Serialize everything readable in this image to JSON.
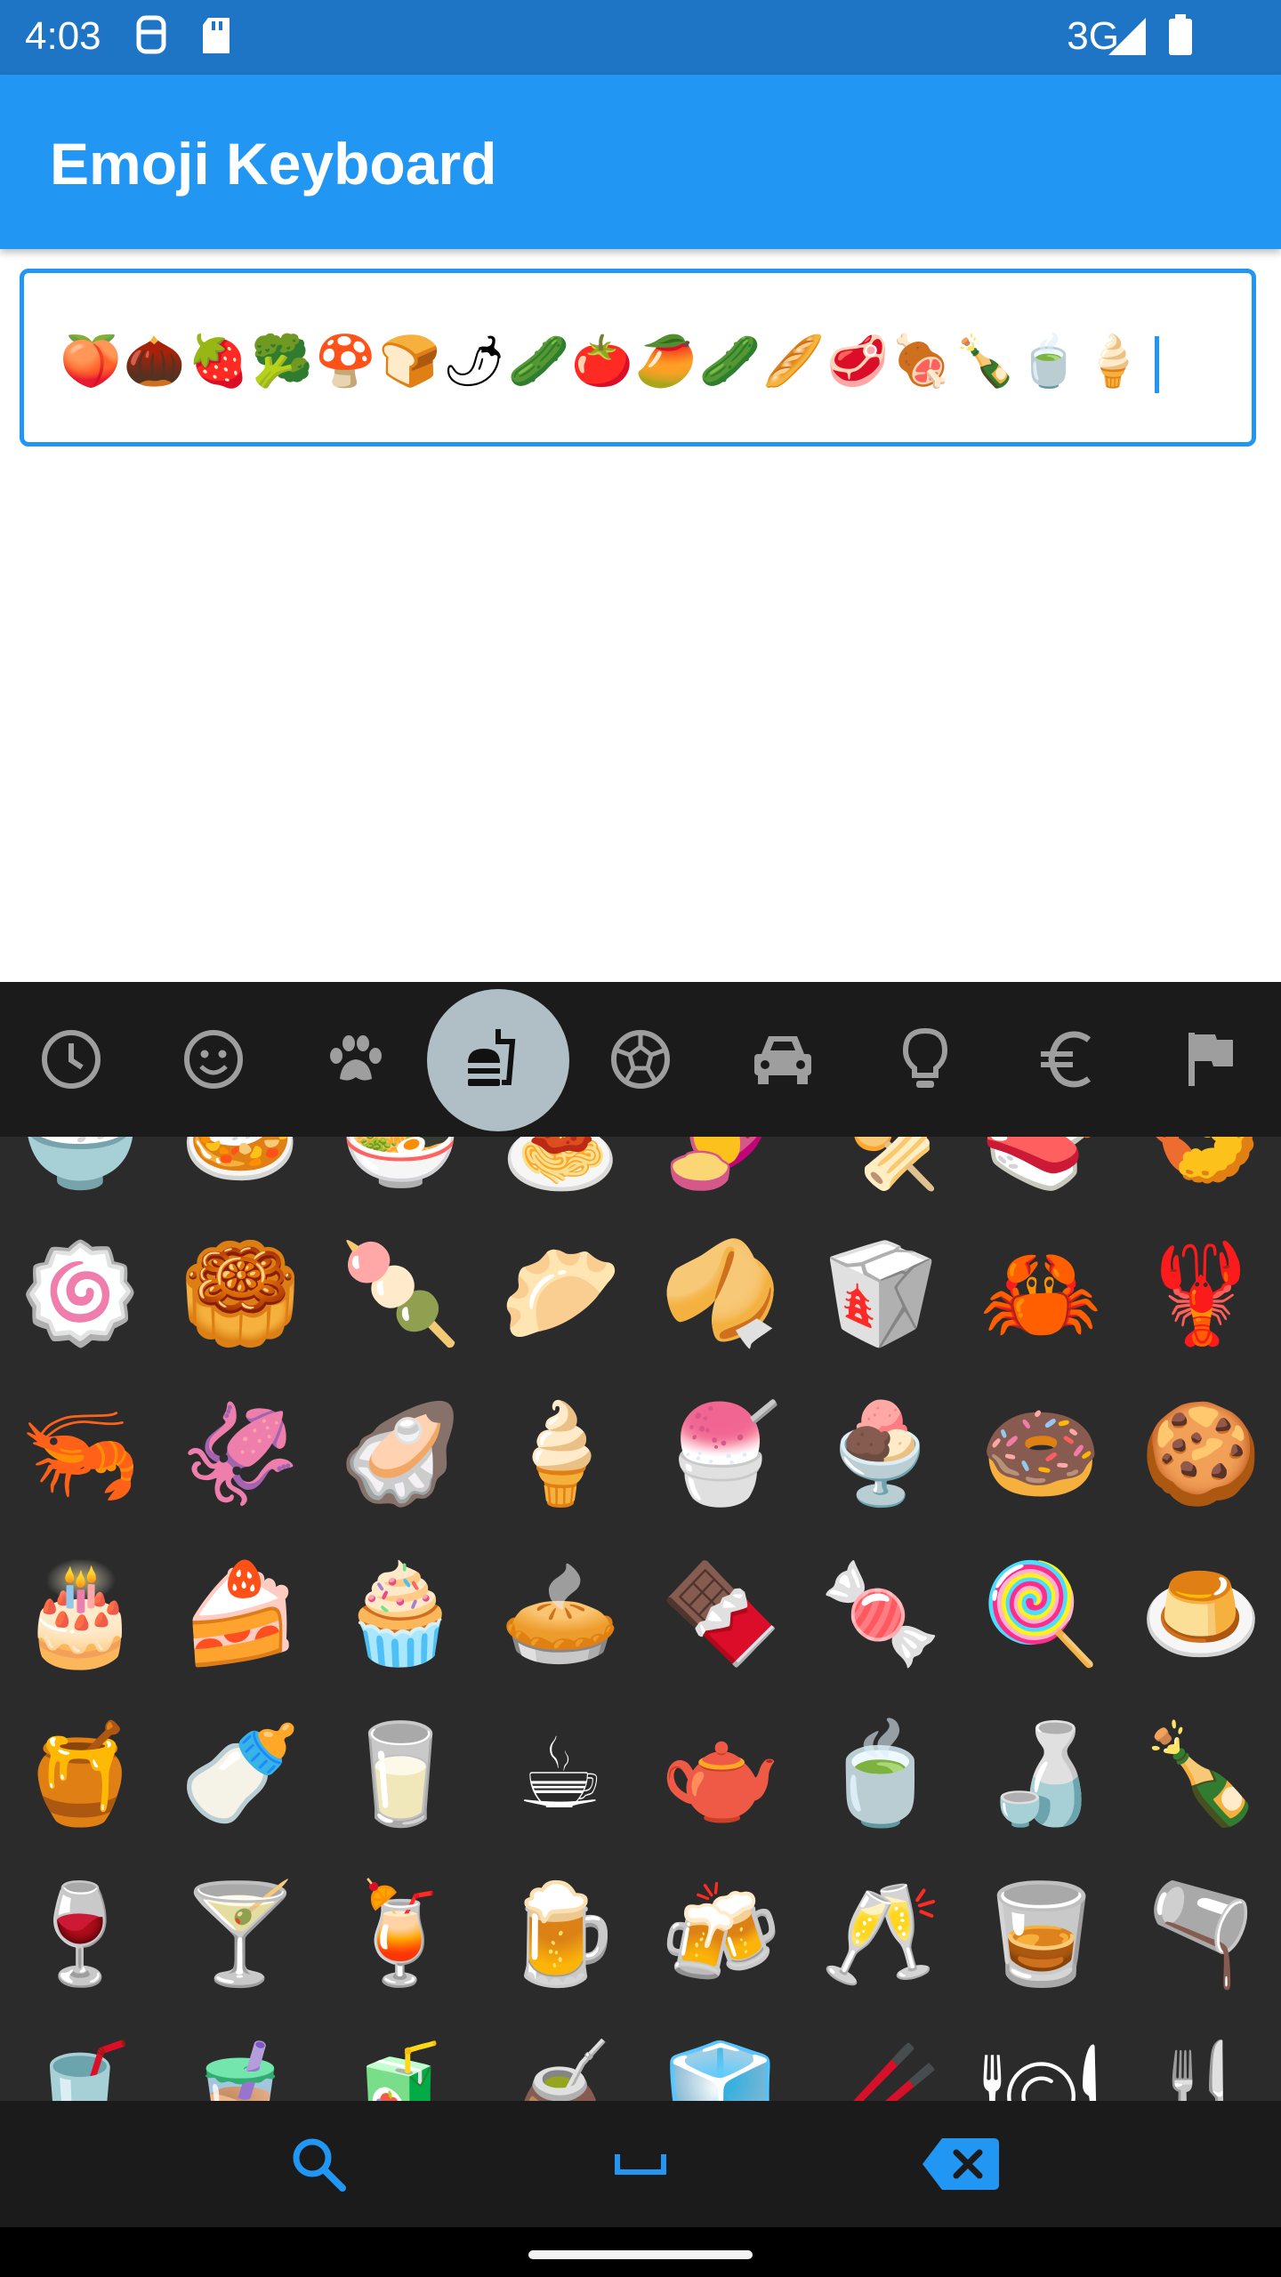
{
  "status_bar": {
    "time": "4:03",
    "network": "3G",
    "icons": [
      "sim-icon",
      "sd-card-icon",
      "signal-icon",
      "battery-icon"
    ]
  },
  "app_bar": {
    "title": "Emoji Keyboard"
  },
  "text_field": {
    "value": "🍑🌰🍓🥦🍄🍞🌶🥒🍅🥭🥒🥖🥩🍖🍾🍵🍦"
  },
  "categories": [
    {
      "name": "recent",
      "icon": "clock-icon"
    },
    {
      "name": "smileys",
      "icon": "smiley-icon"
    },
    {
      "name": "animals",
      "icon": "paw-icon"
    },
    {
      "name": "food",
      "icon": "fastfood-icon",
      "active": true
    },
    {
      "name": "activities",
      "icon": "soccer-ball-icon"
    },
    {
      "name": "travel",
      "icon": "car-icon"
    },
    {
      "name": "objects",
      "icon": "lightbulb-icon"
    },
    {
      "name": "symbols",
      "icon": "euro-icon"
    },
    {
      "name": "flags",
      "icon": "flag-icon"
    }
  ],
  "emoji_rows": [
    [
      "🍚",
      "🍛",
      "🍜",
      "🍝",
      "🍠",
      "🍢",
      "🍣",
      "🍤"
    ],
    [
      "🍥",
      "🥮",
      "🍡",
      "🥟",
      "🥠",
      "🥡",
      "🦀",
      "🦞"
    ],
    [
      "🦐",
      "🦑",
      "🦪",
      "🍦",
      "🍧",
      "🍨",
      "🍩",
      "🍪"
    ],
    [
      "🎂",
      "🍰",
      "🧁",
      "🥧",
      "🍫",
      "🍬",
      "🍭",
      "🍮"
    ],
    [
      "🍯",
      "🍼",
      "🥛",
      "☕",
      "🫖",
      "🍵",
      "🍶",
      "🍾"
    ],
    [
      "🍷",
      "🍸",
      "🍹",
      "🍺",
      "🍻",
      "🥂",
      "🥃",
      "🫗"
    ],
    [
      "🥤",
      "🧋",
      "🧃",
      "🧉",
      "🧊",
      "🥢",
      "🍽",
      "🍴"
    ]
  ],
  "bottom_bar": {
    "icons": [
      "search-icon",
      "space-icon",
      "backspace-icon"
    ],
    "accent": "#2196F3"
  },
  "colors": {
    "status_bar": "#1E74C5",
    "app_bar": "#2196F3",
    "keyboard_bg": "#2b2b2b",
    "category_bg": "#1b1b1b",
    "active_bubble": "#B0BEC5"
  }
}
